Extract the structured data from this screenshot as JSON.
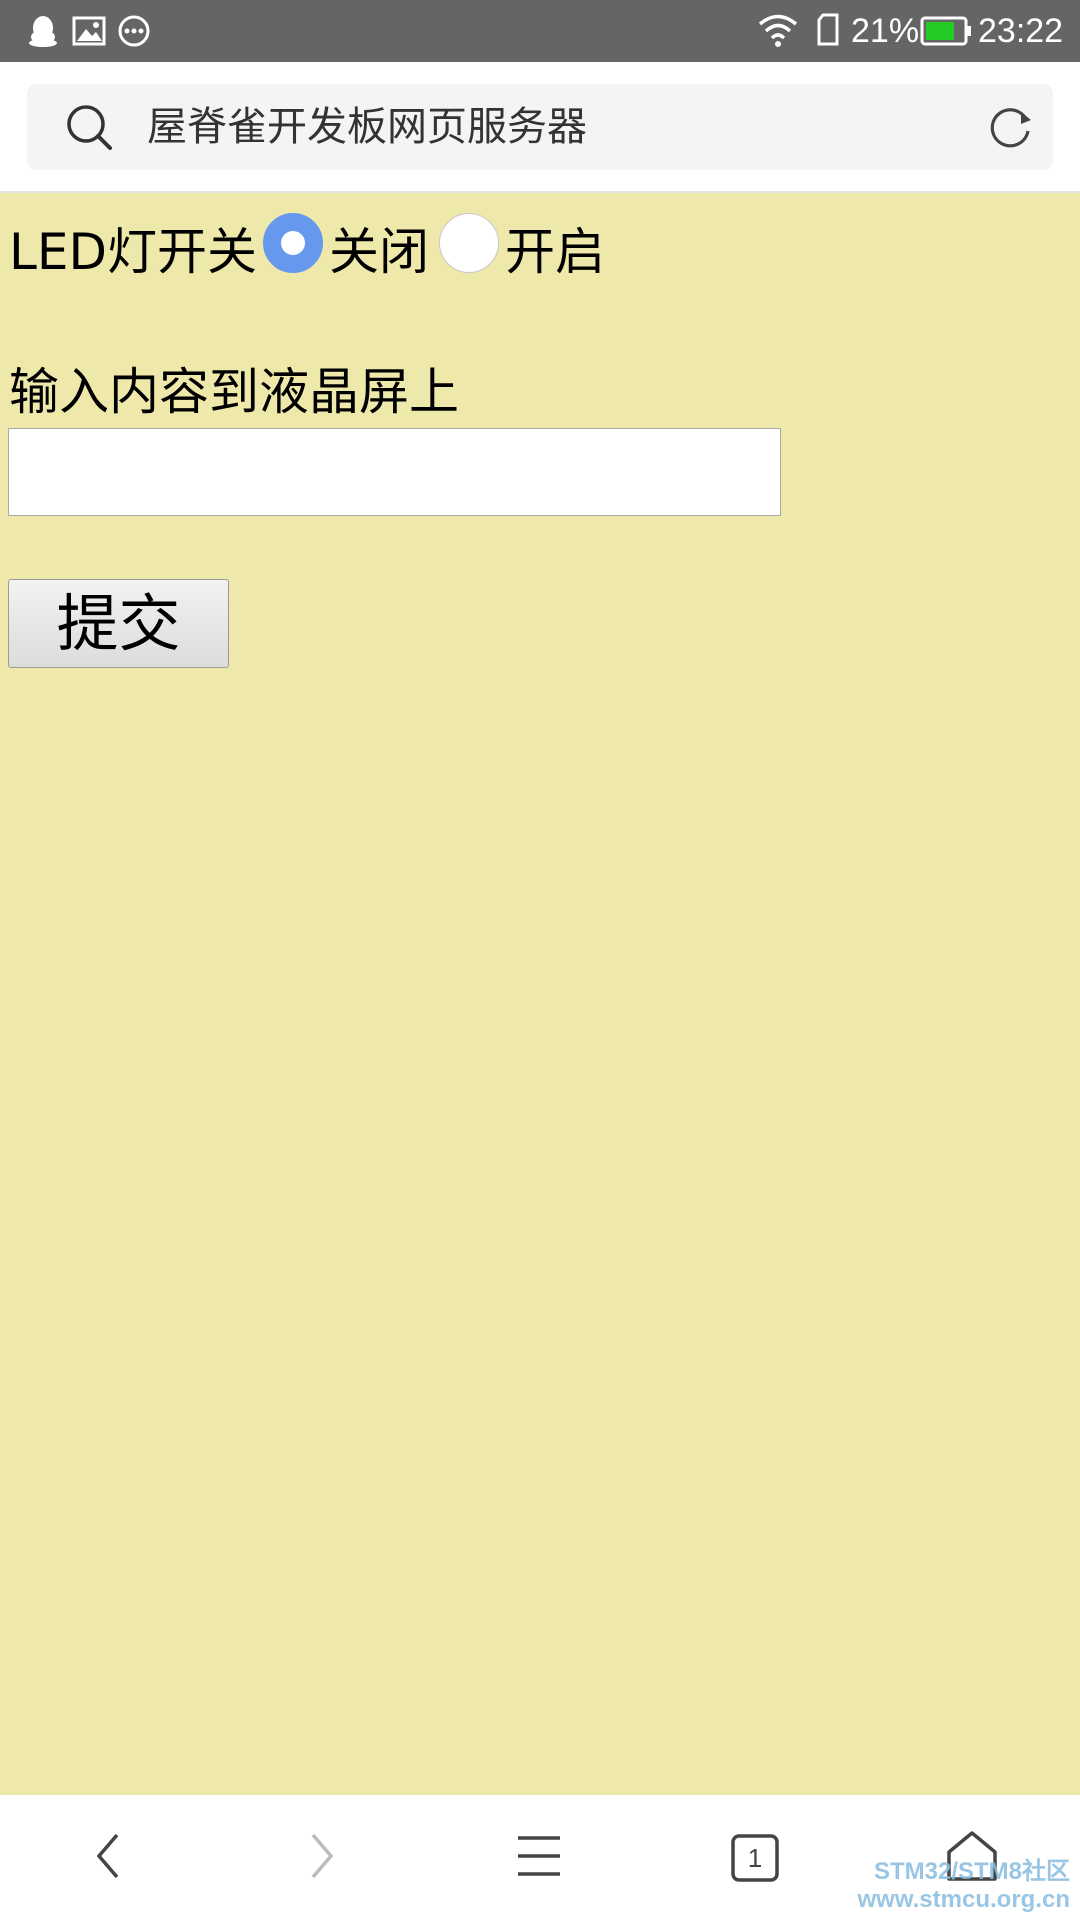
{
  "status_bar": {
    "battery": "21%",
    "time": "23:22",
    "icons": [
      "qq-icon",
      "image-icon",
      "more-dots-icon",
      "wifi-icon",
      "sim-icon",
      "battery-icon"
    ],
    "battery_color": "#22cc22"
  },
  "address_bar": {
    "title": "屋脊雀开发板网页服务器"
  },
  "page": {
    "background": "#eee8aa",
    "led_label": "LED灯开关",
    "radio_off_label": "关闭",
    "radio_on_label": "开启",
    "selected": "关闭",
    "lcd_label": "输入内容到液晶屏上",
    "lcd_input_value": "",
    "submit_label": "提交",
    "accent": "#6699ee"
  },
  "bottom_nav": {
    "tab_count": "1",
    "items": [
      "back-icon",
      "forward-icon",
      "menu-icon",
      "tabs-icon",
      "home-icon"
    ]
  },
  "watermark": {
    "line1": "STM32/STM8社区",
    "line2": "www.stmcu.org.cn"
  }
}
